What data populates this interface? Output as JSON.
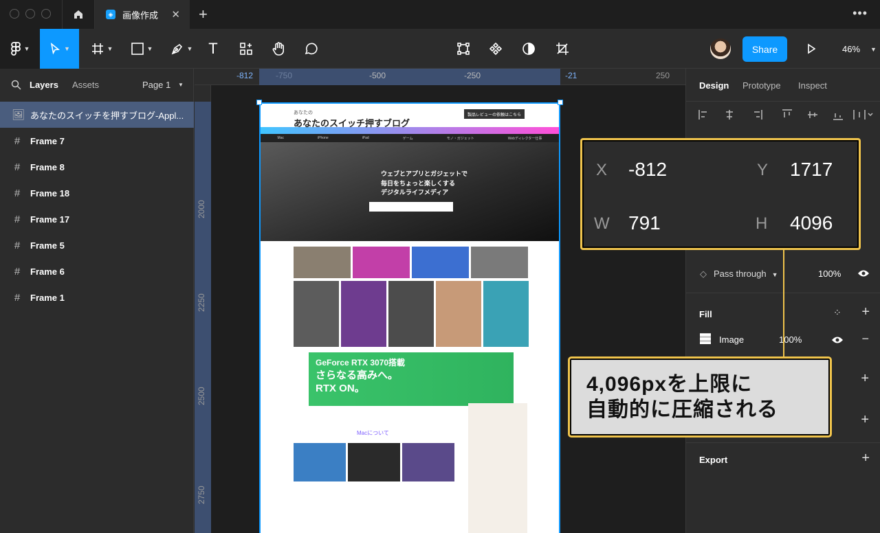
{
  "titlebar": {
    "file_tab": "画像作成",
    "close": "✕",
    "new_tab": "+",
    "more": "•••"
  },
  "toolbar": {
    "share": "Share",
    "zoom": "46%",
    "text_tool": "T"
  },
  "left_panel": {
    "tabs": {
      "layers": "Layers",
      "assets": "Assets",
      "page": "Page 1"
    },
    "layers": [
      {
        "label": "あなたのスイッチを押すブログ-Appl...",
        "icon": "image-icon",
        "selected": true
      },
      {
        "label": "Frame 7",
        "icon": "frame-icon"
      },
      {
        "label": "Frame 8",
        "icon": "frame-icon"
      },
      {
        "label": "Frame 18",
        "icon": "frame-icon"
      },
      {
        "label": "Frame 17",
        "icon": "frame-icon"
      },
      {
        "label": "Frame 5",
        "icon": "frame-icon"
      },
      {
        "label": "Frame 6",
        "icon": "frame-icon"
      },
      {
        "label": "Frame 1",
        "icon": "frame-icon"
      }
    ]
  },
  "canvas": {
    "ruler_top": [
      "-812",
      "-750",
      "-500",
      "-250",
      "-21",
      "250"
    ],
    "ruler_left": [
      "2000",
      "2250",
      "2500",
      "2750"
    ],
    "webpage": {
      "logo": "あなたのスイッチ押すブログ",
      "logo_small": "あなたの",
      "header_btn": "製品レビューの依頼はこちら",
      "nav": [
        "Mac",
        "iPhone",
        "iPad",
        "ゲーム",
        "モノ・ガジェット",
        "Webディレクター仕事"
      ],
      "hero_line1": "ウェブとアプリとガジェットで",
      "hero_line2": "毎日をちょっと楽しくする",
      "hero_line3": "デジタルライフメディア",
      "ad_line1": "GeForce RTX 3070搭載",
      "ad_line2": "さらなる高みへ。",
      "ad_line3": "RTX ON。",
      "section": "Macについて"
    }
  },
  "right_panel": {
    "tabs": {
      "design": "Design",
      "prototype": "Prototype",
      "inspect": "Inspect"
    },
    "layer": {
      "blend": "Pass through",
      "opacity": "100%"
    },
    "fill": {
      "title": "Fill",
      "type": "Image",
      "opacity": "100%"
    },
    "export": "Export"
  },
  "callout": {
    "x_label": "X",
    "x_value": "-812",
    "y_label": "Y",
    "y_value": "1717",
    "w_label": "W",
    "w_value": "791",
    "h_label": "H",
    "h_value": "4096"
  },
  "note": {
    "line1": "4,096pxを上限に",
    "line2": "自動的に圧縮される"
  },
  "colors": {
    "accent": "#0d99ff",
    "highlight": "#f0c44c",
    "selection": "#4a5d7e"
  }
}
